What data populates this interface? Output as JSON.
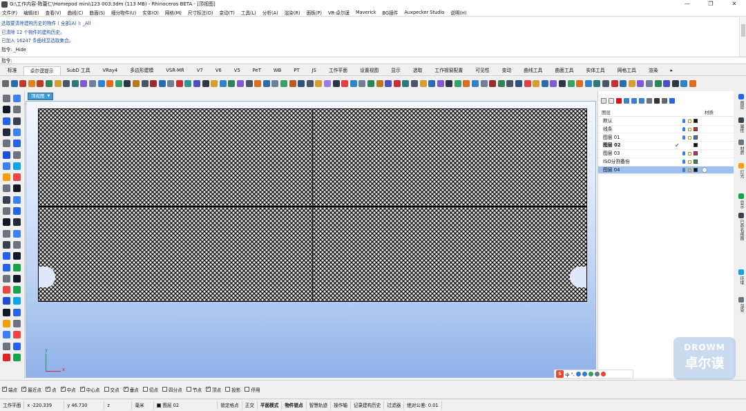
{
  "window": {
    "title": "G:\\工作内容-陈蕾仁\\Homepod mini\\123 003.3dm (113 MB) - Rhinoceros BETA - [顶视图]",
    "controls": [
      "—",
      "❐",
      "✕"
    ]
  },
  "menu": [
    "文件(F)",
    "编辑(E)",
    "查看(V)",
    "曲线(C)",
    "曲面(S)",
    "细分物件(U)",
    "实体(O)",
    "网格(M)",
    "尺寸标注(D)",
    "变动(T)",
    "工具(L)",
    "分析(A)",
    "渲染(R)",
    "面板(P)",
    "VR-卓尔谟",
    "Maverick",
    "BG插件",
    "Auxpecker Studio",
    "说明(H)"
  ],
  "command_history": [
    "选取要清除建构历史的物件 ( 全部(A) ): _All",
    "已清除 12 个物件的建构历史。",
    "已加入 16247 条曲线至选取集合。",
    "指令: _Hide"
  ],
  "command_prompt": "指令:",
  "tabs": [
    "标准",
    "卓尔谟提示",
    "SubD 工具",
    "VRay4",
    "多边形建模",
    "VSR-MR",
    "V7",
    "V6",
    "V5",
    "PeT",
    "WB",
    "PT",
    "JS",
    "工作平面",
    "设置视图",
    "显示",
    "选取",
    "工作视窗配置",
    "可见性",
    "变动",
    "曲线工具",
    "曲面工具",
    "实体工具",
    "网格工具",
    "渲染"
  ],
  "active_tab": "卓尔谟提示",
  "toolbar_icon_colors": [
    "#6b6b6b",
    "#2b6cb0",
    "#c0392b",
    "#e67e22",
    "#c0392b",
    "#2f855a",
    "#d69e2e",
    "#4a5568",
    "#2c7a7b",
    "#805ad5",
    "#718096",
    "#3182ce",
    "#dd6b20",
    "#38a169",
    "#2d3748",
    "#b7791f",
    "#4a5568",
    "#9b2c2c",
    "#2b6cb0",
    "#718096",
    "#c53030",
    "#319795",
    "#4c51bf",
    "#2d3748",
    "#d69e2e",
    "#3182ce",
    "#2f855a",
    "#805ad5",
    "#4a5568",
    "#dd6b20",
    "#2b6cb0",
    "#718096",
    "#38a169",
    "#c05621",
    "#2c5282",
    "#4a5568",
    "#d69e2e",
    "#9f7aea",
    "#2d3748",
    "#e53e3e",
    "#3182ce",
    "#718096",
    "#2f855a",
    "#b7791f",
    "#4c51bf",
    "#c53030",
    "#2c7a7b",
    "#4a5568",
    "#d69e2e",
    "#2b6cb0",
    "#805ad5",
    "#2d3748",
    "#38a169",
    "#dd6b20",
    "#3182ce",
    "#718096",
    "#9b2c2c",
    "#2f855a",
    "#4a5568",
    "#2c5282",
    "#e53e3e",
    "#d69e2e",
    "#2b6cb0",
    "#805ad5",
    "#2d3748",
    "#38a169",
    "#dd6b20",
    "#3182ce",
    "#2c7a7b",
    "#4a5568",
    "#c53030",
    "#2b6cb0",
    "#d69e2e",
    "#805ad5",
    "#718096",
    "#2f855a",
    "#4c51bf",
    "#2d3748",
    "#3182ce",
    "#dd6b20"
  ],
  "viewport": {
    "label": "顶视图",
    "axis_x": "x",
    "axis_y": "y"
  },
  "layers": {
    "header_name": "图层",
    "header_material": "材质",
    "rows": [
      {
        "name": "默认",
        "color": "#111111",
        "current": false,
        "selected": false
      },
      {
        "name": "线条",
        "color": "#e02020",
        "current": false,
        "selected": false
      },
      {
        "name": "图层 01",
        "color": "#1e7fd8",
        "current": false,
        "selected": false
      },
      {
        "name": "图层 02",
        "color": "#111111",
        "current": true,
        "selected": false
      },
      {
        "name": "图层 03",
        "color": "#d81e8c",
        "current": false,
        "selected": false
      },
      {
        "name": "ISO分割备份",
        "color": "#1e9e3a",
        "current": false,
        "selected": false
      },
      {
        "name": "图层 04",
        "color": "#111111",
        "current": false,
        "selected": true
      }
    ]
  },
  "side_tabs": [
    "图层",
    "属性",
    "材质",
    "灯光",
    "显示",
    "已命名视图",
    "环境",
    "渲染"
  ],
  "ime": {
    "s": "S",
    "mode": "中",
    "punct": "°,"
  },
  "watermark": {
    "line1": "DROWM",
    "line2": "卓尔谟"
  },
  "osnaps": [
    {
      "label": "端点",
      "on": true
    },
    {
      "label": "最近点",
      "on": true
    },
    {
      "label": "点",
      "on": true
    },
    {
      "label": "中点",
      "on": true
    },
    {
      "label": "中心点",
      "on": true
    },
    {
      "label": "交点",
      "on": false
    },
    {
      "label": "垂点",
      "on": true
    },
    {
      "label": "切点",
      "on": false
    },
    {
      "label": "四分点",
      "on": false
    },
    {
      "label": "节点",
      "on": false
    },
    {
      "label": "顶点",
      "on": true
    },
    {
      "label": "投影",
      "on": false
    },
    {
      "label": "停用",
      "on": false
    }
  ],
  "status": {
    "cplane": "工作平面",
    "x": "x -220.339",
    "y": "y 46.730",
    "z": "z",
    "units": "毫米",
    "layer": "图层 02",
    "items": [
      "锁定格点",
      "正交",
      "平面模式",
      "物件锁点",
      "智慧轨迹",
      "操作轴",
      "记录建构历史",
      "过滤器",
      "绝对公差: 0.01"
    ]
  }
}
